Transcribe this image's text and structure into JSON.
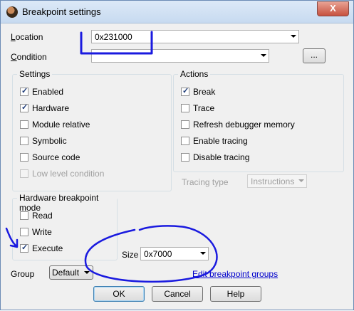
{
  "window": {
    "title": "Breakpoint settings",
    "close_glyph": "X"
  },
  "location": {
    "label": "Location",
    "value": "0x231000"
  },
  "condition": {
    "label": "Condition",
    "value": "",
    "browse_label": "..."
  },
  "settings": {
    "title": "Settings",
    "items": [
      {
        "label": "Enabled",
        "checked": true,
        "disabled": false
      },
      {
        "label": "Hardware",
        "checked": true,
        "disabled": false
      },
      {
        "label": "Module relative",
        "checked": false,
        "disabled": false
      },
      {
        "label": "Symbolic",
        "checked": false,
        "disabled": false
      },
      {
        "label": "Source code",
        "checked": false,
        "disabled": false
      },
      {
        "label": "Low level condition",
        "checked": false,
        "disabled": true
      }
    ]
  },
  "actions": {
    "title": "Actions",
    "items": [
      {
        "label": "Break",
        "checked": true
      },
      {
        "label": "Trace",
        "checked": false
      },
      {
        "label": "Refresh debugger memory",
        "checked": false
      },
      {
        "label": "Enable tracing",
        "checked": false
      },
      {
        "label": "Disable tracing",
        "checked": false
      }
    ],
    "tracing_type": {
      "label": "Tracing type",
      "value": "Instructions"
    }
  },
  "hw_mode": {
    "title": "Hardware breakpoint mode",
    "items": [
      {
        "label": "Read",
        "checked": false
      },
      {
        "label": "Write",
        "checked": false
      },
      {
        "label": "Execute",
        "checked": true
      }
    ],
    "size": {
      "label": "Size",
      "value": "0x7000"
    }
  },
  "group": {
    "label": "Group",
    "value": "Default",
    "edit_link": "Edit breakpoint groups"
  },
  "buttons": {
    "ok": "OK",
    "cancel": "Cancel",
    "help": "Help"
  },
  "colors": {
    "annotation_ink": "#1a1adf",
    "link": "#0000cc"
  }
}
